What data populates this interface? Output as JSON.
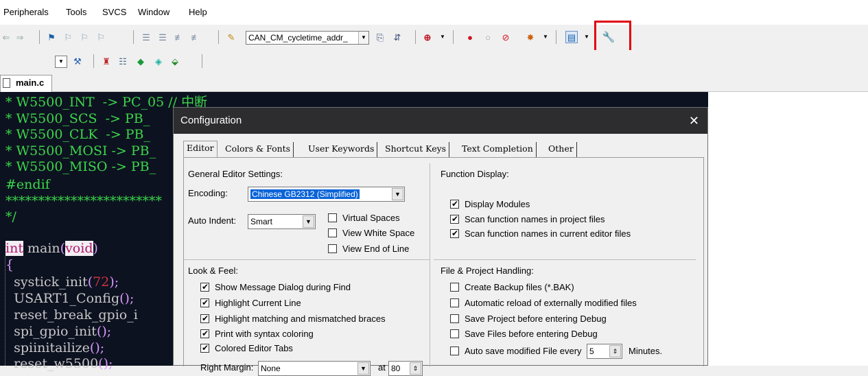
{
  "menubar": {
    "items": [
      "Peripherals",
      "Tools",
      "SVCS",
      "Window",
      "Help"
    ]
  },
  "toolbar": {
    "target_combo": "CAN_CM_cycletime_addr_",
    "icons": [
      "back-arrow-icon",
      "forward-arrow-icon",
      "bookmark-icon",
      "prev-bookmark-icon",
      "next-bookmark-icon",
      "clear-bookmarks-icon",
      "indent-icon",
      "unindent-icon",
      "comment-icon",
      "uncomment-icon",
      "find-in-files-icon",
      "find-icon",
      "incremental-find-icon",
      "debug-session-icon",
      "breakpoint-icon",
      "disable-breakpoint-icon",
      "kill-breakpoints-icon",
      "kill-all-icon",
      "window-layout-icon",
      "configuration-wrench-icon"
    ],
    "highlight_color": "#e1000f"
  },
  "toolbar2": {
    "icons": [
      "target-select-icon",
      "magic-wand-icon",
      "load-icon",
      "options-icon",
      "manage-rte-icon",
      "select-packs-icon",
      "pack-installer-icon"
    ]
  },
  "tabs": {
    "main_file": "main.c"
  },
  "editor": {
    "lines": [
      {
        "a": "* W5500_INT  -> PC_05 // 中断"
      },
      {
        "a": "* W5500_SCS  -> PB_"
      },
      {
        "a": "* W5500_CLK  -> PB_"
      },
      {
        "a": "* W5500_MOSI -> PB_"
      },
      {
        "a": "* W5500_MISO -> PB_"
      },
      {
        "a": "#endif"
      },
      {
        "a": "************************"
      },
      {
        "a": "*/"
      }
    ],
    "main_kw": "int",
    "main_name": " main",
    "main_void": "void",
    "open_paren": "(",
    "close_paren": ")",
    "brace": "{",
    "calls": [
      {
        "name": "  systick_init",
        "arg": "72",
        "tail": ");"
      },
      {
        "name": "  USART1_Config",
        "arg": "",
        "tail": ");"
      },
      {
        "name": "  reset_break_gpio_i",
        "arg": "",
        "tail": ""
      },
      {
        "name": "  spi_gpio_init",
        "arg": "",
        "tail": ");"
      },
      {
        "name": "  spiinitailize",
        "arg": "",
        "tail": ");"
      },
      {
        "name": "  reset_w5500",
        "arg": "",
        "tail": ");"
      }
    ]
  },
  "dialog": {
    "title": "Configuration",
    "close": "✕",
    "tabs": [
      "Editor",
      "Colors & Fonts",
      "User Keywords",
      "Shortcut Keys",
      "Text Completion",
      "Other"
    ],
    "general": {
      "heading": "General Editor Settings:",
      "encoding_label": "Encoding:",
      "encoding_value": "Chinese GB2312 (Simplified)",
      "auto_indent_label": "Auto Indent:",
      "auto_indent_value": "Smart",
      "virtual_spaces": "Virtual Spaces",
      "view_white_space": "View White Space",
      "view_end_of_line": "View End of Line"
    },
    "function_display": {
      "heading": "Function Display:",
      "display_modules": "Display Modules",
      "scan_project": "Scan function names in project files",
      "scan_editor": "Scan function names in current editor files"
    },
    "look_feel": {
      "heading": "Look & Feel:",
      "show_message": "Show Message Dialog during Find",
      "highlight_line": "Highlight Current Line",
      "highlight_braces": "Highlight matching and mismatched braces",
      "print_syntax": "Print with syntax coloring",
      "colored_tabs": "Colored Editor Tabs",
      "right_margin_label": "Right Margin:",
      "right_margin_value": "None",
      "at_label": "at",
      "at_value": "80"
    },
    "file_project": {
      "heading": "File & Project Handling:",
      "create_backup": "Create Backup files (*.BAK)",
      "auto_reload": "Automatic reload of externally modified files",
      "save_project": "Save Project before entering Debug",
      "save_files": "Save Files before entering Debug",
      "auto_save": "Auto save modified File every",
      "auto_save_value": "5",
      "minutes": "Minutes."
    }
  }
}
